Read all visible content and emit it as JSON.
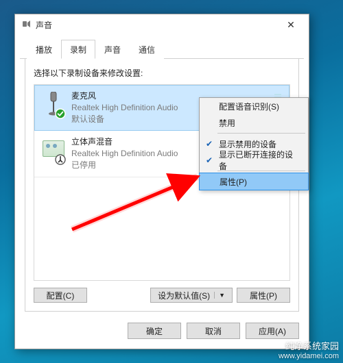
{
  "window": {
    "title": "声音",
    "close_label": "✕"
  },
  "tabs": [
    {
      "label": "播放"
    },
    {
      "label": "录制"
    },
    {
      "label": "声音"
    },
    {
      "label": "通信"
    }
  ],
  "instruction": "选择以下录制设备来修改设置:",
  "devices": [
    {
      "title": "麦克风",
      "driver": "Realtek High Definition Audio",
      "status": "默认设备",
      "selected": true,
      "badge": "default"
    },
    {
      "title": "立体声混音",
      "driver": "Realtek High Definition Audio",
      "status": "已停用",
      "selected": false,
      "badge": "disabled"
    }
  ],
  "context_menu": {
    "configure": "配置语音识别(S)",
    "disable": "禁用",
    "show_disabled": "显示禁用的设备",
    "show_disconnected": "显示已断开连接的设备",
    "properties": "属性(P)"
  },
  "buttons": {
    "configure": "配置(C)",
    "set_default": "设为默认值(S)",
    "properties": "属性(P)",
    "ok": "确定",
    "cancel": "取消",
    "apply": "应用(A)"
  },
  "watermark": {
    "line1": "纯净系统家园",
    "line2": "www.yidamei.com"
  }
}
